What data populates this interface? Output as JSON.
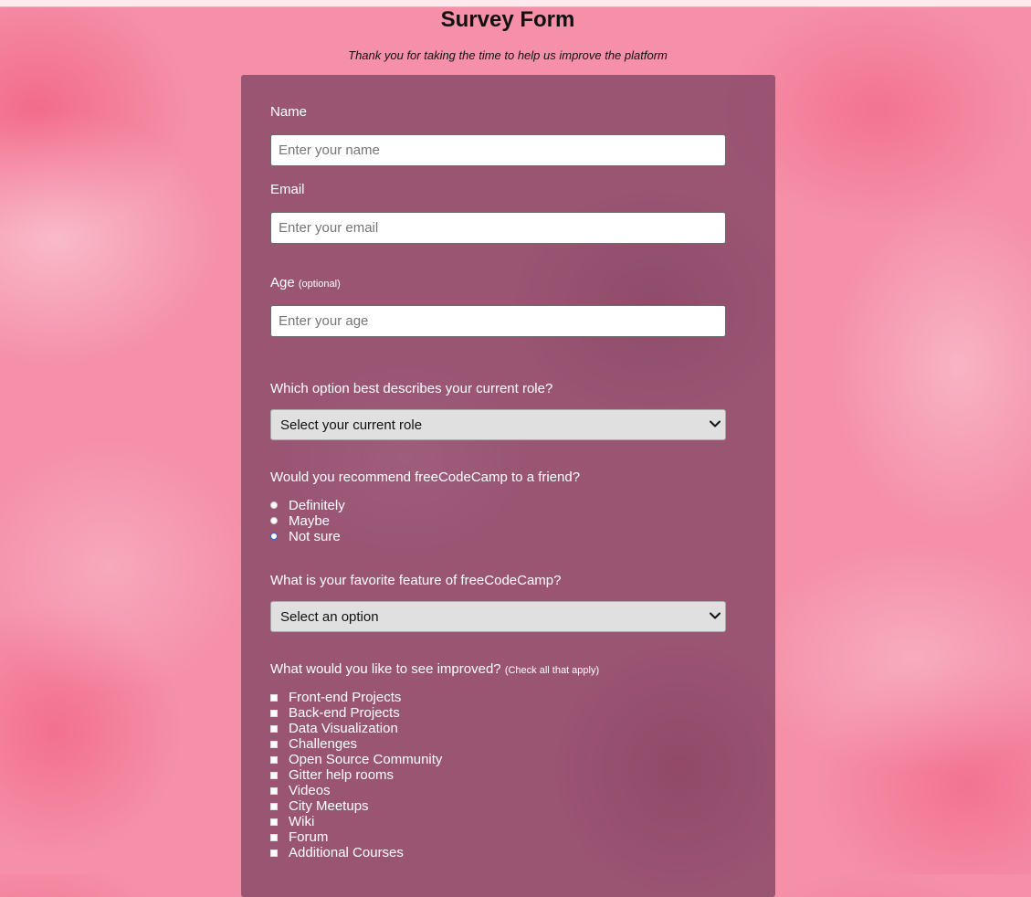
{
  "page": {
    "title": "Survey Form",
    "description": "Thank you for taking the time to help us improve the platform"
  },
  "form": {
    "name_label": "Name",
    "name_placeholder": "Enter your name",
    "email_label": "Email",
    "email_placeholder": "Enter your email",
    "age_label": "Age",
    "age_label_note": "(optional)",
    "age_placeholder": "Enter your age",
    "role_question": "Which option best describes your current role?",
    "role_selected": "Select your current role",
    "recommend_question": "Would you recommend freeCodeCamp to a friend?",
    "recommend_options": [
      "Definitely",
      "Maybe",
      "Not sure"
    ],
    "recommend_focused": "Not sure",
    "feature_question": "What is your favorite feature of freeCodeCamp?",
    "feature_selected": "Select an option",
    "improve_question": "What would you like to see improved?",
    "improve_note": "(Check all that apply)",
    "improve_options": [
      "Front-end Projects",
      "Back-end Projects",
      "Data Visualization",
      "Challenges",
      "Open Source Community",
      "Gitter help rooms",
      "Videos",
      "City Meetups",
      "Wiki",
      "Forum",
      "Additional Courses"
    ]
  },
  "icons": {
    "select_chevron": "chevron-down-icon"
  },
  "colors": {
    "card_bg": "#804464",
    "radio_focus": "#2a6bd6",
    "page_bg": "#f590a8"
  }
}
